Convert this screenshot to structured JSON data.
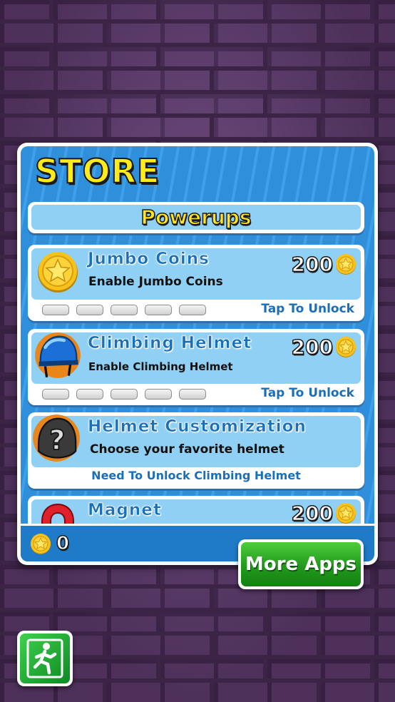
{
  "store": {
    "title": "STORE",
    "section_label": "Powerups",
    "coin_balance": "0",
    "accent": "#2f8fdb",
    "title_color": "#ffeb1a"
  },
  "items": [
    {
      "title": "Jumbo Coins",
      "description": "Enable Jumbo Coins",
      "price": "200",
      "icon": "star-coin-icon",
      "upgrade_level": 0,
      "upgrade_max": 5,
      "action": "Tap To Unlock"
    },
    {
      "title": "Climbing Helmet",
      "description": "Enable Climbing Helmet",
      "price": "200",
      "icon": "helmet-icon",
      "upgrade_level": 0,
      "upgrade_max": 5,
      "action": "Tap To Unlock"
    },
    {
      "title": "Helmet Customization",
      "description": "Choose your favorite helmet",
      "icon": "locked-helmet-icon",
      "status": "Need To Unlock Climbing Helmet"
    },
    {
      "title": "Magnet",
      "price": "200",
      "icon": "magnet-icon"
    }
  ],
  "buttons": {
    "more_apps": "More Apps",
    "exit_icon": "running-exit-icon"
  }
}
